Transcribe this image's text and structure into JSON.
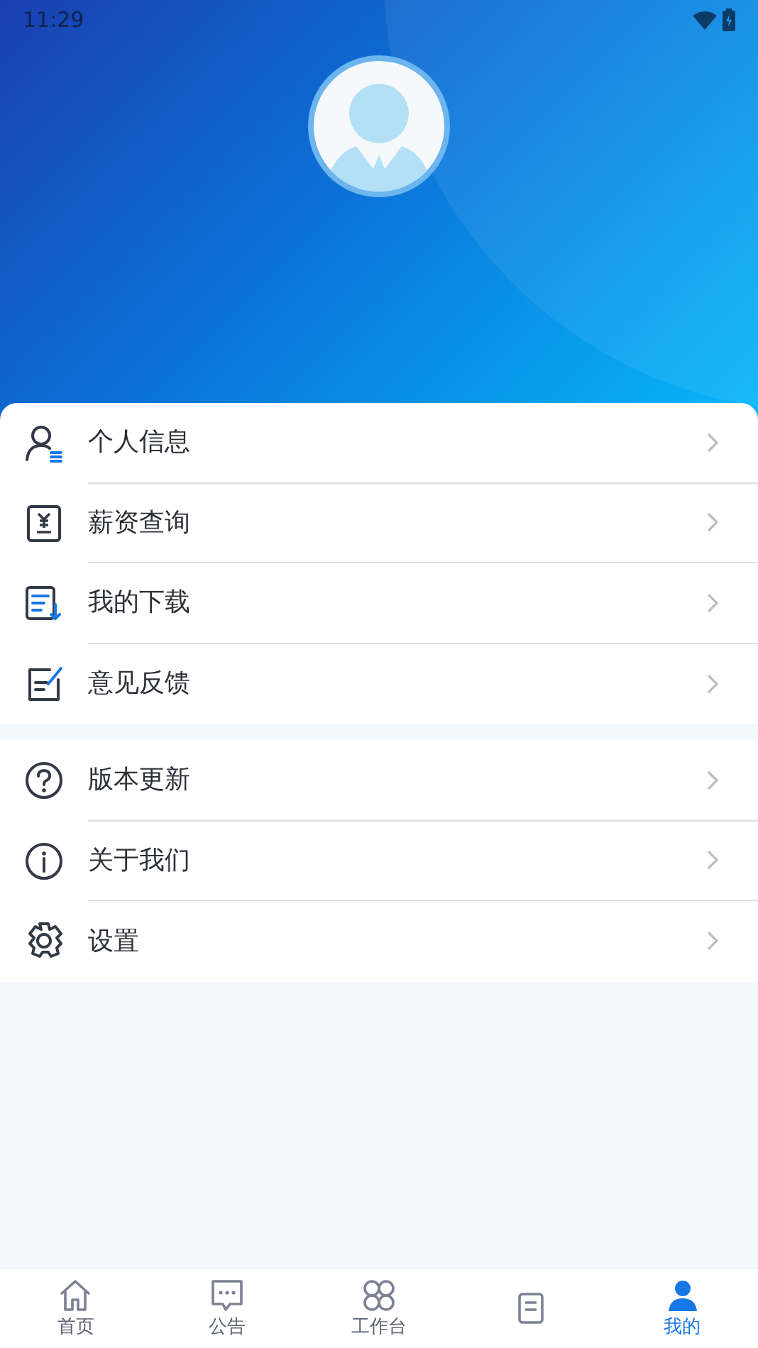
{
  "status_bar": {
    "time": "11:29"
  },
  "menu_groups": [
    {
      "items": [
        {
          "label": "个人信息"
        },
        {
          "label": "薪资查询"
        },
        {
          "label": "我的下载"
        },
        {
          "label": "意见反馈"
        }
      ]
    },
    {
      "items": [
        {
          "label": "版本更新"
        },
        {
          "label": "关于我们"
        },
        {
          "label": "设置"
        }
      ]
    }
  ],
  "tab_bar": [
    {
      "label": "首页",
      "selected": false
    },
    {
      "label": "公告",
      "selected": false
    },
    {
      "label": "工作台",
      "selected": false
    },
    {
      "selected": false
    },
    {
      "label": "我的",
      "selected": true
    }
  ]
}
